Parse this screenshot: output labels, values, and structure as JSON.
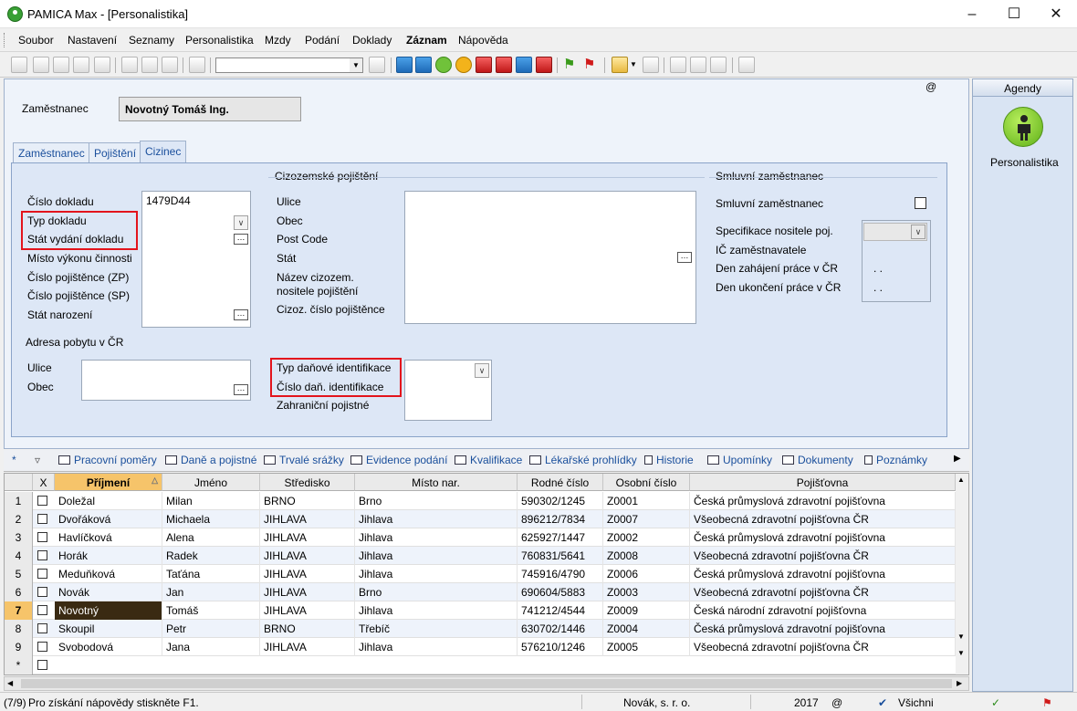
{
  "window": {
    "title": "PAMICA Max - [Personalistika]"
  },
  "menu": [
    "Soubor",
    "Nastavení",
    "Seznamy",
    "Personalistika",
    "Mzdy",
    "Podání",
    "Doklady",
    "Záznam",
    "Nápověda"
  ],
  "employee": {
    "label": "Zaměstnanec",
    "value": "Novotný Tomáš Ing.",
    "at_sign": "@"
  },
  "tabs": [
    "Zaměstnanec",
    "Pojištění",
    "Cizinec"
  ],
  "active_tab": "Cizinec",
  "left_section": {
    "fields": [
      "Číslo dokladu",
      "Typ dokladu",
      "Stát vydání dokladu",
      "Místo výkonu činnosti",
      "Číslo pojištěnce (ZP)",
      "Číslo pojištěnce (SP)",
      "Stát narození"
    ],
    "cislo_dokladu_value": "1479D44",
    "address_header": "Adresa pobytu v ČR",
    "address_fields": [
      "Ulice",
      "Obec"
    ]
  },
  "foreign_insurance": {
    "header": "Cizozemské pojištění",
    "fields": [
      "Ulice",
      "Obec",
      "Post Code",
      "Stát"
    ],
    "name_label_line1": "Název cizozem.",
    "name_label_line2": "nositele pojištění",
    "cislo_label": "Cizoz. číslo pojištěnce",
    "tax_fields": [
      "Typ daňové identifikace",
      "Číslo daň. identifikace",
      "Zahraniční pojistné"
    ]
  },
  "contract": {
    "header": "Smluvní zaměstnanec",
    "checkbox_label": "Smluvní zaměstnanec",
    "fields": [
      "Specifikace nositele poj.",
      "IČ zaměstnavatele",
      "Den zahájení práce v ČR",
      "Den ukončení práce v ČR"
    ],
    "date_placeholders": [
      ". .",
      ". ."
    ]
  },
  "agenda": {
    "header": "Agendy",
    "item": "Personalistika"
  },
  "bottom_tabs": [
    "Pracovní poměry",
    "Daně a pojistné",
    "Trvalé srážky",
    "Evidence podání",
    "Kvalifikace",
    "Lékařské prohlídky",
    "Historie",
    "Upomínky",
    "Dokumenty",
    "Poznámky"
  ],
  "grid": {
    "columns": [
      "X",
      "Příjmení",
      "Jméno",
      "Středisko",
      "Místo nar.",
      "Rodné číslo",
      "Osobní číslo",
      "Pojišťovna"
    ],
    "rows": [
      {
        "n": "1",
        "prijmeni": "Doležal",
        "jmeno": "Milan",
        "stredisko": "BRNO",
        "misto": "Brno",
        "rc": "590302/1245",
        "oc": "Z0001",
        "poj": "Česká průmyslová zdravotní pojišťovna"
      },
      {
        "n": "2",
        "prijmeni": "Dvořáková",
        "jmeno": "Michaela",
        "stredisko": "JIHLAVA",
        "misto": "Jihlava",
        "rc": "896212/7834",
        "oc": "Z0007",
        "poj": "Všeobecná zdravotní pojišťovna ČR"
      },
      {
        "n": "3",
        "prijmeni": "Havlíčková",
        "jmeno": "Alena",
        "stredisko": "JIHLAVA",
        "misto": "Jihlava",
        "rc": "625927/1447",
        "oc": "Z0002",
        "poj": "Česká průmyslová zdravotní pojišťovna"
      },
      {
        "n": "4",
        "prijmeni": "Horák",
        "jmeno": "Radek",
        "stredisko": "JIHLAVA",
        "misto": "Jihlava",
        "rc": "760831/5641",
        "oc": "Z0008",
        "poj": "Všeobecná zdravotní pojišťovna ČR"
      },
      {
        "n": "5",
        "prijmeni": "Meduňková",
        "jmeno": "Taťána",
        "stredisko": "JIHLAVA",
        "misto": "Jihlava",
        "rc": "745916/4790",
        "oc": "Z0006",
        "poj": "Česká průmyslová zdravotní pojišťovna"
      },
      {
        "n": "6",
        "prijmeni": "Novák",
        "jmeno": "Jan",
        "stredisko": "JIHLAVA",
        "misto": "Brno",
        "rc": "690604/5883",
        "oc": "Z0003",
        "poj": "Všeobecná zdravotní pojišťovna ČR"
      },
      {
        "n": "7",
        "prijmeni": "Novotný",
        "jmeno": "Tomáš",
        "stredisko": "JIHLAVA",
        "misto": "Jihlava",
        "rc": "741212/4544",
        "oc": "Z0009",
        "poj": "Česká národní zdravotní pojišťovna"
      },
      {
        "n": "8",
        "prijmeni": "Skoupil",
        "jmeno": "Petr",
        "stredisko": "BRNO",
        "misto": "Třebíč",
        "rc": "630702/1446",
        "oc": "Z0004",
        "poj": "Česká průmyslová zdravotní pojišťovna"
      },
      {
        "n": "9",
        "prijmeni": "Svobodová",
        "jmeno": "Jana",
        "stredisko": "JIHLAVA",
        "misto": "Jihlava",
        "rc": "576210/1246",
        "oc": "Z0005",
        "poj": "Všeobecná zdravotní pojišťovna ČR"
      }
    ],
    "new_row_marker": "*",
    "selected_row": "7",
    "record_nav": "*"
  },
  "status": {
    "position": "(7/9)",
    "help": "Pro získání nápovědy stiskněte F1.",
    "company": "Novák, s. r. o.",
    "year": "2017",
    "at": "@",
    "filter": "Všichni"
  },
  "colors": {
    "accent_blue": "#1a4f9c",
    "selected_row": "#3a2a12",
    "highlight": "#e3141c"
  }
}
